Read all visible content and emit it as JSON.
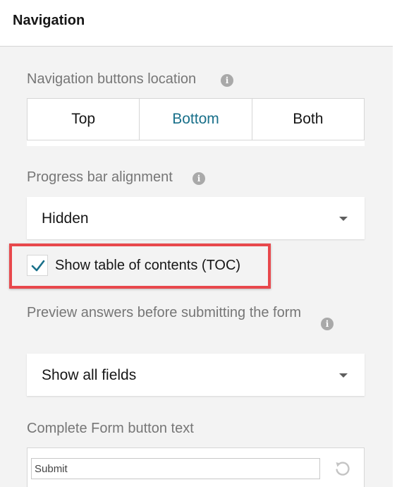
{
  "header": {
    "title": "Navigation"
  },
  "navigation_buttons": {
    "label": "Navigation buttons location",
    "info_icon": "i",
    "options": [
      "Top",
      "Bottom",
      "Both"
    ],
    "selected": "Bottom"
  },
  "progress_bar": {
    "label": "Progress bar alignment",
    "info_icon": "i",
    "value": "Hidden"
  },
  "toc": {
    "label": "Show table of contents (TOC)",
    "checked": true
  },
  "preview": {
    "label": "Preview answers before submitting the form",
    "info_icon": "i",
    "value": "Show all fields"
  },
  "complete_button": {
    "label": "Complete Form button text",
    "value": "Submit"
  },
  "colors": {
    "accent": "#19708a",
    "highlight": "#e8484c",
    "panel_bg": "#f3f3f3",
    "label_gray": "#767676"
  },
  "icons": {
    "info": "info-icon",
    "caret": "chevron-down-icon",
    "check": "check-icon",
    "reset": "reset-icon"
  }
}
